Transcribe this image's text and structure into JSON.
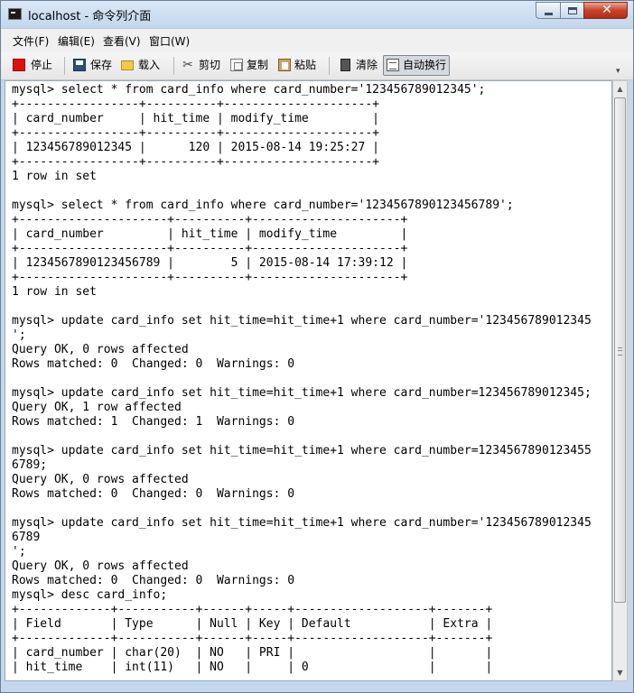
{
  "window": {
    "title": "localhost - 命令列介面"
  },
  "menu": {
    "items": [
      {
        "label": "文件(F)"
      },
      {
        "label": "编辑(E)"
      },
      {
        "label": "查看(V)"
      },
      {
        "label": "窗口(W)"
      }
    ]
  },
  "toolbar": {
    "stop": "停止",
    "save": "保存",
    "load": "载入",
    "cut": "剪切",
    "copy": "复制",
    "paste": "粘贴",
    "clear": "清除",
    "wrap": "自动换行",
    "wrap_pressed": true
  },
  "console": {
    "text": "mysql> select * from card_info where card_number='123456789012345';\n+-----------------+----------+---------------------+\n| card_number     | hit_time | modify_time         |\n+-----------------+----------+---------------------+\n| 123456789012345 |      120 | 2015-08-14 19:25:27 |\n+-----------------+----------+---------------------+\n1 row in set\n\nmysql> select * from card_info where card_number='1234567890123456789';\n+---------------------+----------+---------------------+\n| card_number         | hit_time | modify_time         |\n+---------------------+----------+---------------------+\n| 1234567890123456789 |        5 | 2015-08-14 17:39:12 |\n+---------------------+----------+---------------------+\n1 row in set\n\nmysql> update card_info set hit_time=hit_time+1 where card_number='123456789012345\n';\nQuery OK, 0 rows affected\nRows matched: 0  Changed: 0  Warnings: 0\n\nmysql> update card_info set hit_time=hit_time+1 where card_number=123456789012345;\nQuery OK, 1 row affected\nRows matched: 1  Changed: 1  Warnings: 0\n\nmysql> update card_info set hit_time=hit_time+1 where card_number=1234567890123455\n6789;\nQuery OK, 0 rows affected\nRows matched: 0  Changed: 0  Warnings: 0\n\nmysql> update card_info set hit_time=hit_time+1 where card_number='123456789012345\n6789\n';\nQuery OK, 0 rows affected\nRows matched: 0  Changed: 0  Warnings: 0\nmysql> desc card_info;\n+-------------+-----------+------+-----+-------------------+-------+\n| Field       | Type      | Null | Key | Default           | Extra |\n+-------------+-----------+------+-----+-------------------+-------+\n| card_number | char(20)  | NO   | PRI |                   |       |\n| hit_time    | int(11)   | NO   |     | 0                 |       |"
  },
  "icons": {
    "app": "terminal-icon",
    "stop": "stop-icon",
    "save": "save-icon",
    "load": "folder-icon",
    "cut": "scissors-icon",
    "copy": "copy-icon",
    "paste": "clipboard-icon",
    "clear": "clear-icon",
    "wrap": "word-wrap-icon"
  },
  "colors": {
    "titlebar": "#c2d6ec",
    "close_button": "#c8432b",
    "console_bg": "#ffffff",
    "console_text": "#000000"
  }
}
